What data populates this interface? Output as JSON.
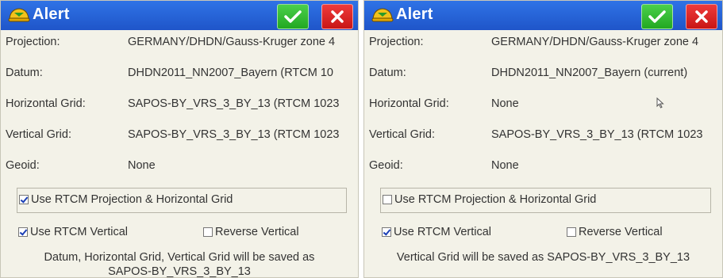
{
  "dialogs": [
    {
      "title": "Alert",
      "ok_icon": "checkmark-icon",
      "cancel_icon": "close-x-icon",
      "fields": [
        {
          "label": "Projection:",
          "value": "GERMANY/DHDN/Gauss-Kruger zone 4"
        },
        {
          "label": "Datum:",
          "value": "DHDN2011_NN2007_Bayern (RTCM 10"
        },
        {
          "label": "Horizontal Grid:",
          "value": "SAPOS-BY_VRS_3_BY_13 (RTCM 1023"
        },
        {
          "label": "Vertical Grid:",
          "value": "SAPOS-BY_VRS_3_BY_13 (RTCM 1023"
        },
        {
          "label": "Geoid:",
          "value": "None"
        }
      ],
      "use_rtcm_projection": {
        "label": "Use RTCM Projection & Horizontal Grid",
        "checked": true
      },
      "use_rtcm_vertical": {
        "label": "Use RTCM Vertical",
        "checked": true
      },
      "reverse_vertical": {
        "label": "Reverse Vertical",
        "checked": false
      },
      "footer_line1": "Datum, Horizontal Grid, Vertical Grid will be saved as",
      "footer_line2": "SAPOS-BY_VRS_3_BY_13"
    },
    {
      "title": "Alert",
      "ok_icon": "checkmark-icon",
      "cancel_icon": "close-x-icon",
      "fields": [
        {
          "label": "Projection:",
          "value": "GERMANY/DHDN/Gauss-Kruger zone 4"
        },
        {
          "label": "Datum:",
          "value": "DHDN2011_NN2007_Bayern (current)"
        },
        {
          "label": "Horizontal Grid:",
          "value": "None"
        },
        {
          "label": "Vertical Grid:",
          "value": "SAPOS-BY_VRS_3_BY_13 (RTCM 1023"
        },
        {
          "label": "Geoid:",
          "value": "None"
        }
      ],
      "use_rtcm_projection": {
        "label": "Use RTCM Projection & Horizontal Grid",
        "checked": false
      },
      "use_rtcm_vertical": {
        "label": "Use RTCM Vertical",
        "checked": true
      },
      "reverse_vertical": {
        "label": "Reverse Vertical",
        "checked": false
      },
      "footer_line1": "Vertical Grid will be saved as SAPOS-BY_VRS_3_BY_13",
      "footer_line2": ""
    }
  ],
  "colors": {
    "titlebar": "#1f55c9",
    "ok_button": "#22a822",
    "cancel_button": "#c81616",
    "dialog_background": "#f3f2e8"
  }
}
